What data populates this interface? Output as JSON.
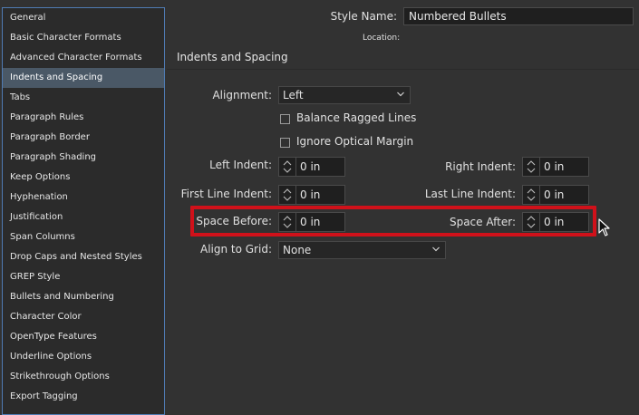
{
  "sidebar": {
    "items": [
      {
        "label": "General"
      },
      {
        "label": "Basic Character Formats"
      },
      {
        "label": "Advanced Character Formats"
      },
      {
        "label": "Indents and Spacing"
      },
      {
        "label": "Tabs"
      },
      {
        "label": "Paragraph Rules"
      },
      {
        "label": "Paragraph Border"
      },
      {
        "label": "Paragraph Shading"
      },
      {
        "label": "Keep Options"
      },
      {
        "label": "Hyphenation"
      },
      {
        "label": "Justification"
      },
      {
        "label": "Span Columns"
      },
      {
        "label": "Drop Caps and Nested Styles"
      },
      {
        "label": "GREP Style"
      },
      {
        "label": "Bullets and Numbering"
      },
      {
        "label": "Character Color"
      },
      {
        "label": "OpenType Features"
      },
      {
        "label": "Underline Options"
      },
      {
        "label": "Strikethrough Options"
      },
      {
        "label": "Export Tagging"
      }
    ],
    "selected": "Indents and Spacing"
  },
  "header": {
    "style_name_label": "Style Name:",
    "style_name_value": "Numbered Bullets",
    "location_label": "Location:"
  },
  "section": {
    "title": "Indents and Spacing"
  },
  "form": {
    "alignment_label": "Alignment:",
    "alignment_value": "Left",
    "balance_ragged_lines_label": "Balance Ragged Lines",
    "balance_ragged_lines_checked": false,
    "ignore_optical_margin_label": "Ignore Optical Margin",
    "ignore_optical_margin_checked": false,
    "left_indent_label": "Left Indent:",
    "left_indent_value": "0 in",
    "right_indent_label": "Right Indent:",
    "right_indent_value": "0 in",
    "first_line_indent_label": "First Line Indent:",
    "first_line_indent_value": "0 in",
    "last_line_indent_label": "Last Line Indent:",
    "last_line_indent_value": "0 in",
    "space_before_label": "Space Before:",
    "space_before_value": "0 in",
    "space_after_label": "Space After:",
    "space_after_value": "0 in",
    "align_to_grid_label": "Align to Grid:",
    "align_to_grid_value": "None"
  },
  "colors": {
    "background": "#323232",
    "sidebar_border": "#4f7bb3",
    "selected_item": "#4a5866",
    "highlight_box": "#d0111a"
  },
  "icons": {
    "dropdown": "chevron-down-icon",
    "stepper": "stepper-arrows-icon",
    "pointer": "mouse-pointer-icon"
  }
}
